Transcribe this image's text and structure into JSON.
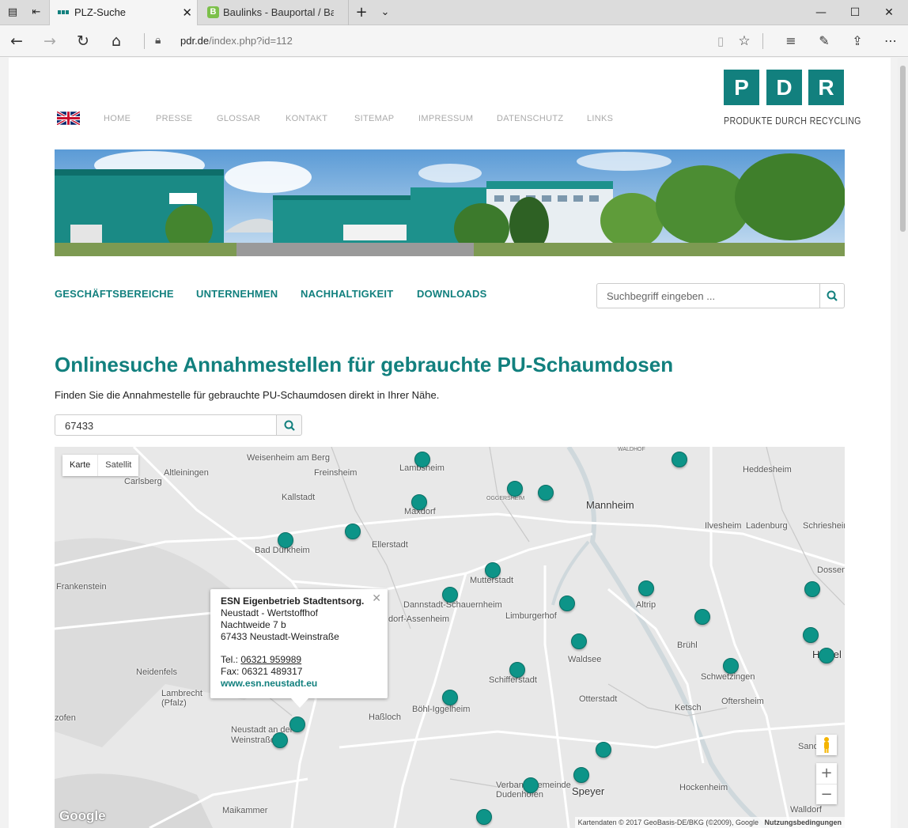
{
  "browser": {
    "tabs": [
      {
        "title": "PLZ-Suche",
        "active": true
      },
      {
        "title": "Baulinks - Bauportal / Baum",
        "active": false
      }
    ],
    "url_host": "pdr.de",
    "url_path": "/index.php?id=112"
  },
  "site": {
    "topnav": [
      "HOME",
      "PRESSE",
      "GLOSSAR",
      "KONTAKT",
      "SITEMAP",
      "IMPRESSUM",
      "DATENSCHUTZ",
      "LINKS"
    ],
    "logo_letters": [
      "P",
      "D",
      "R"
    ],
    "logo_subtitle": "PRODUKTE DURCH RECYCLING",
    "mainnav": [
      "GESCHÄFTSBEREICHE",
      "UNTERNEHMEN",
      "NACHHALTIGKEIT",
      "DOWNLOADS"
    ],
    "search_placeholder": "Suchbegriff eingeben ...",
    "brand_color": "#12807e"
  },
  "content": {
    "title": "Onlinesuche Annahmestellen für gebrauchte PU-Schaumdosen",
    "intro": "Finden Sie die Annahmestelle für gebrauchte PU-Schaumdosen direkt in Ihrer Nähe.",
    "plz_value": "67433"
  },
  "map": {
    "type_buttons": [
      "Karte",
      "Satellit"
    ],
    "places": [
      "Weisenheim am Berg",
      "Altleiningen",
      "Carlsberg",
      "Freinsheim",
      "Lambsheim",
      "Kallstadt",
      "Maxdorf",
      "OGGERSHEIM",
      "Mannheim",
      "Heddesheim",
      "Ilvesheim",
      "Ladenburg",
      "Schriesheim",
      "Bad Dürkheim",
      "Ellerstadt",
      "Mutterstadt",
      "Frankenstein",
      "Dannstadt-Schauernheim",
      "Limburgerhof",
      "Altrip",
      "Dossen",
      "dorf-Assenheim",
      "Brühl",
      "Heidel",
      "Neidenfels",
      "Waldsee",
      "Schwetzingen",
      "Schifferstadt",
      "Lambrecht (Pfalz)",
      "Otterstadt",
      "Oftersheim",
      "zofen",
      "Böhl-Iggelheim",
      "Haßloch",
      "Ketsch",
      "Neustadt an der Weinstraße",
      "Sand",
      "Verbandsgemeinde Dudenhofen",
      "Speyer",
      "Hockenheim",
      "Maikammer",
      "Walldorf",
      "WALDHOF"
    ],
    "info": {
      "name": "ESN Eigenbetrieb Stadtentsorg.",
      "line1": "Neustadt - Wertstoffhof",
      "line2": "Nachtweide 7 b",
      "line3": "67433 Neustadt-Weinstraße",
      "tel_label": "Tel.: ",
      "tel": "06321 959989",
      "fax": "Fax: 06321 489317",
      "web": "www.esn.neustadt.eu"
    },
    "attribution": "Kartendaten © 2017 GeoBasis-DE/BKG (©2009), Google",
    "terms": "Nutzungsbedingungen",
    "google": "Google",
    "marker_color": "#0d9488"
  }
}
